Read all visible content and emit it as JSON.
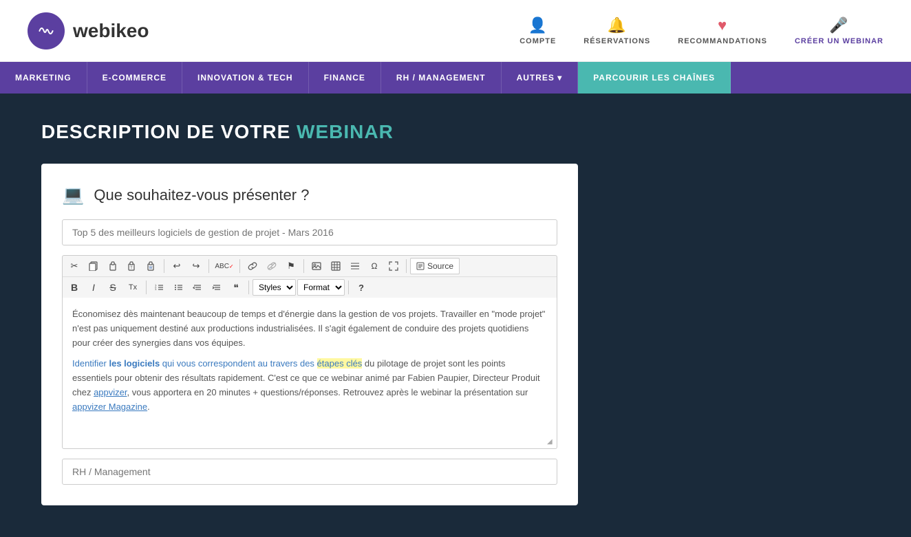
{
  "header": {
    "logo_text_plain": "webi",
    "logo_text_bold": "keo",
    "nav_items": [
      {
        "id": "compte",
        "label": "COMPTE",
        "icon": "👤"
      },
      {
        "id": "reservations",
        "label": "RÉSERVATIONS",
        "icon": "🔔"
      },
      {
        "id": "recommandations",
        "label": "RECOMMANDATIONS",
        "icon": "♥"
      },
      {
        "id": "creer",
        "label_part1": "CRÉER ",
        "label_un": "UN",
        "label_part2": " WEBINAR",
        "icon": "🎤"
      }
    ]
  },
  "nav_bar": {
    "items": [
      {
        "id": "marketing",
        "label": "MARKETING",
        "active": false
      },
      {
        "id": "ecommerce",
        "label": "E-COMMERCE",
        "active": false
      },
      {
        "id": "innovation",
        "label": "INNOVATION & TECH",
        "active": false
      },
      {
        "id": "finance",
        "label": "FINANCE",
        "active": false
      },
      {
        "id": "rh",
        "label": "RH / MANAGEMENT",
        "active": false
      },
      {
        "id": "autres",
        "label": "AUTRES ▾",
        "active": false
      },
      {
        "id": "parcourir",
        "label": "PARCOURIR LES CHAÎNES",
        "active": true
      }
    ]
  },
  "page": {
    "title_part1": "DESCRIPTION DE VOTRE ",
    "title_highlight": "WEBINAR",
    "card": {
      "subtitle_icon": "🖥",
      "subtitle_text": "Que souhaitez-vous présenter ?",
      "title_placeholder": "Top 5 des meilleurs logiciels de gestion de projet - Mars 2016",
      "toolbar": {
        "row1_buttons": [
          "✂",
          "📋",
          "📄",
          "📋",
          "📋",
          "↩",
          "↪",
          "ABC",
          "🔗",
          "🔗",
          "⚑",
          "🖼",
          "▦",
          "≡",
          "Ω",
          "⤢"
        ],
        "source_label": "Source",
        "row2_bold": "B",
        "row2_italic": "I",
        "row2_strike": "S",
        "row2_clear": "Tx",
        "row2_ol": "ol",
        "row2_ul": "ul",
        "row2_indent_out": "←|",
        "row2_indent_in": "|→",
        "row2_quote": "❝",
        "styles_label": "Styles",
        "format_label": "Format",
        "help_label": "?"
      },
      "editor": {
        "paragraph1": "Économisez dès maintenant beaucoup de temps et d'énergie dans la gestion de vos projets. Travailler en \"mode projet\" n'est pas uniquement destiné aux productions industrialisées. Il s'agit également de conduire des projets quotidiens pour créer des synergies dans vos équipes.",
        "paragraph2_pre": "Identifier ",
        "paragraph2_bold1": "les logiciels",
        "paragraph2_mid1": " qui vous correspondent au travers des ",
        "paragraph2_bold2": "étapes clés",
        "paragraph2_mid2": " du pilotage de projet sont les points essentiels pour obtenir des résultats rapidement. C'est ce que ce webinar animé par Fabien Paupier, Directeur Produit chez ",
        "paragraph2_link1": "appvizer",
        "paragraph2_mid3": ", vous apportera en 20 minutes + questions/réponses. Retrouvez après le webinar la présentation sur ",
        "paragraph2_link2": "appvizer Magazine",
        "paragraph2_end": "."
      },
      "category_placeholder": "RH / Management"
    }
  }
}
